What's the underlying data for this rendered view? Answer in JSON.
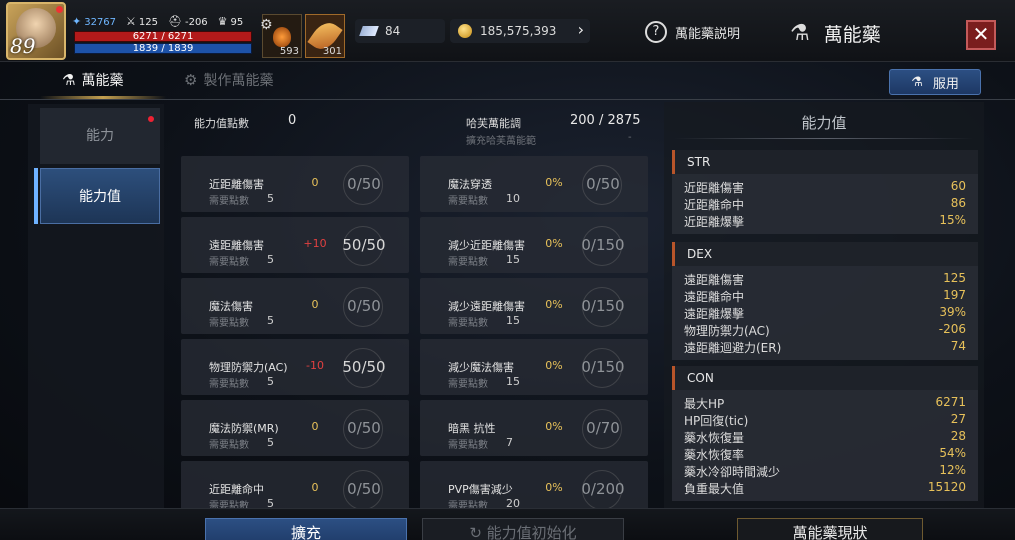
{
  "hud": {
    "level": "89",
    "stat_a": "32767",
    "stat_b": "125",
    "stat_c": "-206",
    "stat_d": "95",
    "hp": "6271 / 6271",
    "mp": "1839 / 1839",
    "slot1_count": "593",
    "slot2_count": "301",
    "diamonds": "84",
    "gold": "185,575,393",
    "help_label": "萬能藥説明",
    "title": "萬能藥",
    "close_icon": "close-icon"
  },
  "tabs": [
    {
      "label": "萬能藥",
      "active": true
    },
    {
      "label": "製作萬能藥",
      "active": false
    }
  ],
  "use_button": "服用",
  "leftnav": [
    {
      "label": "能力",
      "active": false,
      "notify": true
    },
    {
      "label": "能力值",
      "active": true,
      "notify": false
    }
  ],
  "summary": {
    "points_label": "能力值點數",
    "points_value": "0",
    "range_label": "哈芙萬能調",
    "range_value": "200 / 2875",
    "range_sub": "擴充哈芙萬能範",
    "range_dash": "-"
  },
  "cards": [
    {
      "name": "近距離傷害",
      "req_label": "需要點數",
      "req": "5",
      "value": "0",
      "vtype": "zero",
      "level": "0/50",
      "full": false
    },
    {
      "name": "魔法穿透",
      "req_label": "需要點數",
      "req": "10",
      "value": "0%",
      "vtype": "pct",
      "level": "0/50",
      "full": false
    },
    {
      "name": "遠距離傷害",
      "req_label": "需要點數",
      "req": "5",
      "value": "+10",
      "vtype": "pos",
      "level": "50/50",
      "full": true
    },
    {
      "name": "減少近距離傷害",
      "req_label": "需要點數",
      "req": "15",
      "value": "0%",
      "vtype": "pct",
      "level": "0/150",
      "full": false
    },
    {
      "name": "魔法傷害",
      "req_label": "需要點數",
      "req": "5",
      "value": "0",
      "vtype": "zero",
      "level": "0/50",
      "full": false
    },
    {
      "name": "減少遠距離傷害",
      "req_label": "需要點數",
      "req": "15",
      "value": "0%",
      "vtype": "pct",
      "level": "0/150",
      "full": false
    },
    {
      "name": "物理防禦力(AC)",
      "req_label": "需要點數",
      "req": "5",
      "value": "-10",
      "vtype": "neg",
      "level": "50/50",
      "full": true
    },
    {
      "name": "減少魔法傷害",
      "req_label": "需要點數",
      "req": "15",
      "value": "0%",
      "vtype": "pct",
      "level": "0/150",
      "full": false
    },
    {
      "name": "魔法防禦(MR)",
      "req_label": "需要點數",
      "req": "5",
      "value": "0",
      "vtype": "zero",
      "level": "0/50",
      "full": false
    },
    {
      "name": "暗黑 抗性",
      "req_label": "需要點數",
      "req": "7",
      "value": "0%",
      "vtype": "pct",
      "level": "0/70",
      "full": false
    },
    {
      "name": "近距離命中",
      "req_label": "需要點數",
      "req": "5",
      "value": "0",
      "vtype": "zero",
      "level": "0/50",
      "full": false
    },
    {
      "name": "PVP傷害減少",
      "req_label": "需要點數",
      "req": "20",
      "value": "0%",
      "vtype": "pct",
      "level": "0/200",
      "full": false
    }
  ],
  "panel": {
    "title": "能力值",
    "groups": [
      {
        "header": "STR",
        "rows": [
          [
            "近距離傷害",
            "60"
          ],
          [
            "近距離命中",
            "86"
          ],
          [
            "近距離爆擊",
            "15%"
          ]
        ]
      },
      {
        "header": "DEX",
        "rows": [
          [
            "遠距離傷害",
            "125"
          ],
          [
            "遠距離命中",
            "197"
          ],
          [
            "遠距離爆擊",
            "39%"
          ],
          [
            "物理防禦力(AC)",
            "-206"
          ],
          [
            "遠距離迴避力(ER)",
            "74"
          ]
        ]
      },
      {
        "header": "CON",
        "rows": [
          [
            "最大HP",
            "6271"
          ],
          [
            "HP回復(tic)",
            "27"
          ],
          [
            "藥水恢復量",
            "28"
          ],
          [
            "藥水恢復率",
            "54%"
          ],
          [
            "藥水冷卻時間減少",
            "12%"
          ],
          [
            "負重最大值",
            "15120"
          ]
        ]
      }
    ]
  },
  "bottom": {
    "expand": "擴充",
    "reset": "能力值初始化",
    "status": "萬能藥現狀"
  }
}
